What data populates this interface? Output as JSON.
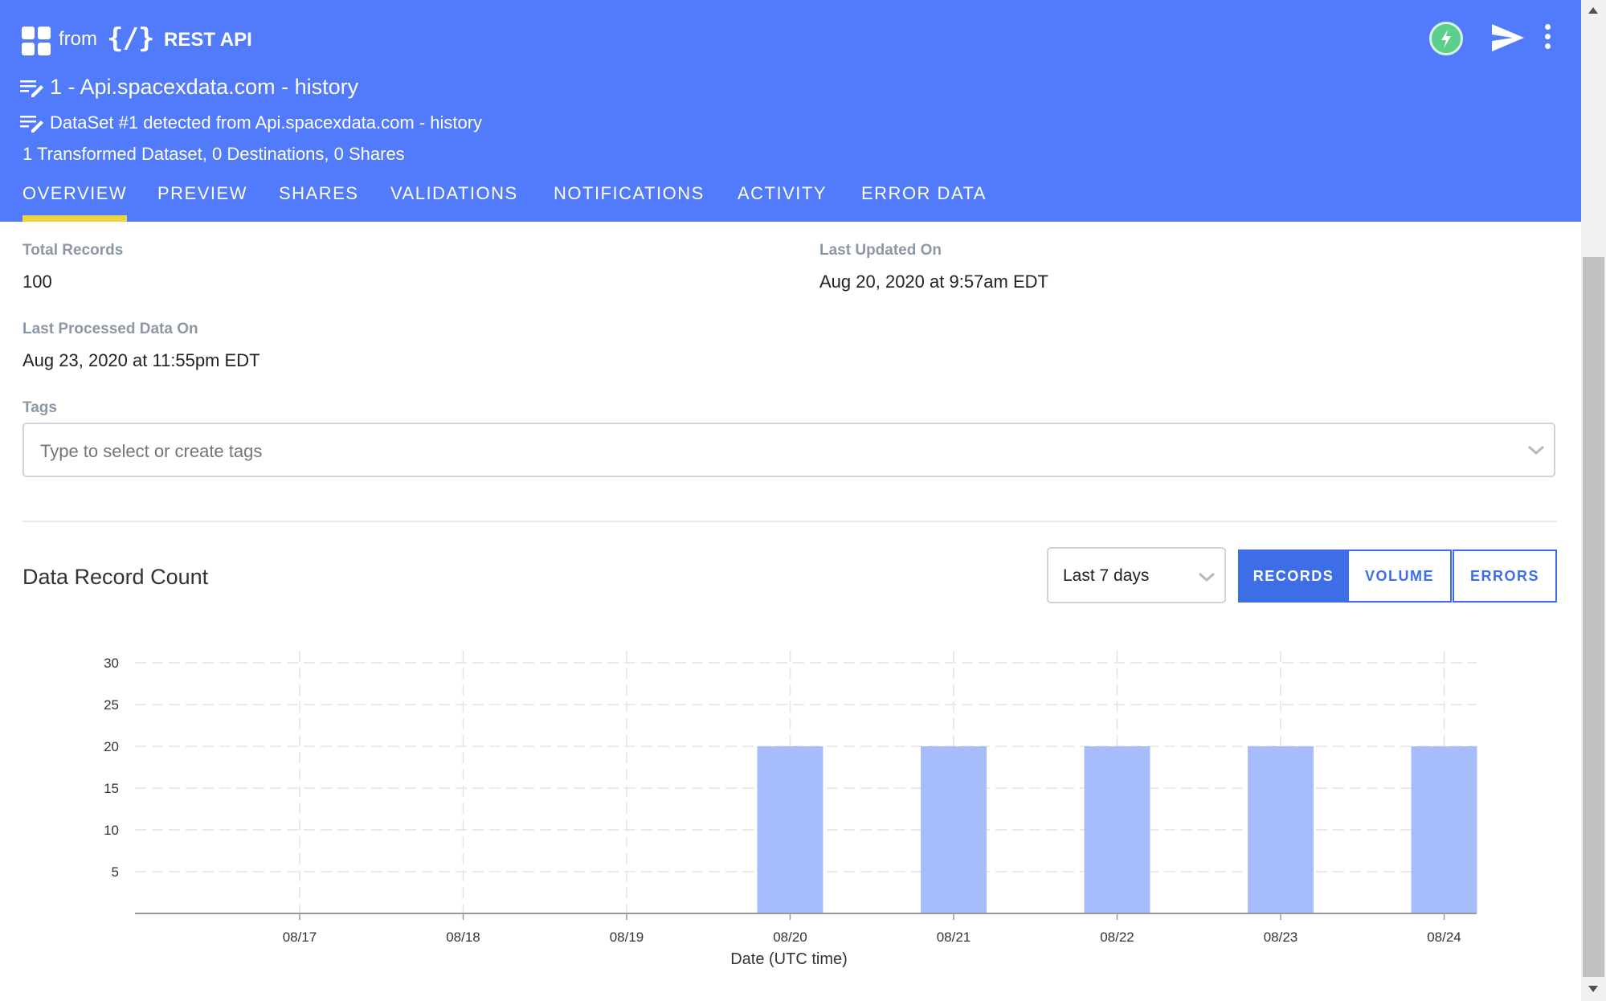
{
  "header": {
    "from_label": "from",
    "source_icon": "{/}",
    "source_name": "REST API",
    "title": "1 - Api.spacexdata.com - history",
    "subtitle": "DataSet #1 detected from Api.spacexdata.com - history",
    "counts": "1 Transformed Dataset, 0 Destinations, 0 Shares"
  },
  "tabs": [
    {
      "label": "OVERVIEW",
      "active": true
    },
    {
      "label": "PREVIEW"
    },
    {
      "label": "SHARES"
    },
    {
      "label": "VALIDATIONS"
    },
    {
      "label": "NOTIFICATIONS"
    },
    {
      "label": "ACTIVITY"
    },
    {
      "label": "ERROR DATA"
    }
  ],
  "overview": {
    "total_records_label": "Total Records",
    "total_records": "100",
    "last_updated_label": "Last Updated On",
    "last_updated": "Aug 20, 2020 at 9:57am EDT",
    "last_processed_label": "Last Processed Data On",
    "last_processed": "Aug 23, 2020 at 11:55pm EDT",
    "tags_label": "Tags",
    "tags_placeholder": "Type to select or create tags"
  },
  "record_section": {
    "title": "Data Record Count",
    "range": "Last 7 days",
    "buttons": {
      "records": "RECORDS",
      "volume": "VOLUME",
      "errors": "ERRORS"
    },
    "active_button": "records"
  },
  "colors": {
    "header": "#517bfb",
    "accent": "#3d6ee8",
    "tab_indicator": "#f0d341",
    "bar": "#a7bcfb",
    "status_icon": "#5bd08a"
  },
  "chart_data": {
    "type": "bar",
    "categories": [
      "08/17",
      "08/18",
      "08/19",
      "08/20",
      "08/21",
      "08/22",
      "08/23",
      "08/24"
    ],
    "values": [
      0,
      0,
      0,
      20,
      20,
      20,
      20,
      20
    ],
    "xlabel": "Date (UTC time)",
    "ylabel": "",
    "yticks": [
      5,
      10,
      15,
      20,
      25,
      30
    ],
    "ylim": [
      0,
      30
    ],
    "grid": true
  }
}
